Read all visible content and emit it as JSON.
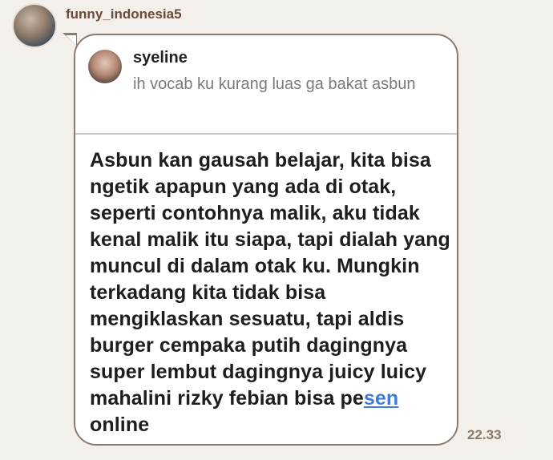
{
  "sender": {
    "name": "funny_indonesia5"
  },
  "reply": {
    "name": "syeline",
    "text": "ih vocab ku kurang luas ga bakat asbun"
  },
  "message": {
    "text_before_link": "Asbun kan gausah belajar, kita bisa ngetik apapun yang ada di otak, seperti contohnya malik, aku tidak kenal malik itu siapa, tapi dialah yang muncul di dalam otak ku. Mungkin terkadang kita tidak bisa mengiklaskan sesuatu, tapi aldis burger cempaka putih dagingnya super lembut dagingnya juicy luicy mahalini rizky febian bisa pe",
    "link_text": "sen",
    "text_after_link": " online"
  },
  "timestamp": "22.33",
  "colors": {
    "background": "#f3efeb",
    "bubble_border": "#8e7a6c",
    "link": "#3f7be3",
    "sender_name": "#6a4a3a"
  }
}
